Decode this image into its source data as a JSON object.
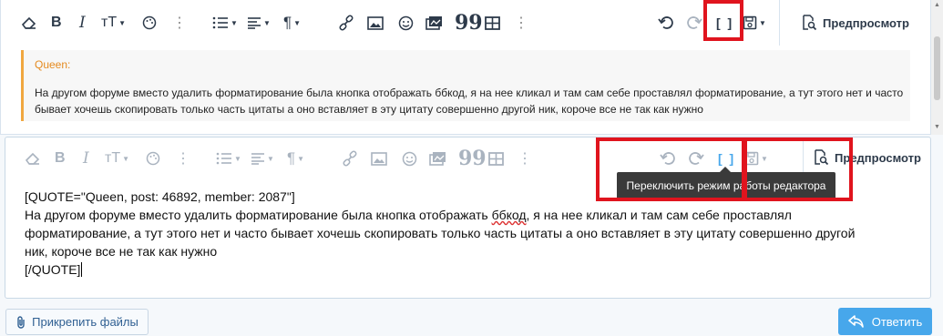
{
  "editor_top": {
    "preview_label": "Предпросмотр",
    "quote": {
      "author": "Queen:",
      "text": "На другом форуме вместо удалить форматирование была кнопка отображать ббкод, я на нее кликал и там сам себе проставлял форматирование, а тут этого нет и часто бывает хочешь скопировать только часть цитаты а оно вставляет в эту цитату совершенно другой ник, короче все не так как нужно"
    },
    "toggle_label": "[ ]"
  },
  "editor_bottom": {
    "preview_label": "Предпросмотр",
    "toggle_label": "[ ]",
    "tooltip": "Переключить режим работы редактора",
    "content": {
      "line1": "[QUOTE=\"Queen, post: 46892, member: 2087\"]",
      "line2a": "На другом форуме вместо удалить форматирование была кнопка отображать ",
      "line2_misspelled": "ббкод",
      "line2b": ", я на нее кликал и там сам себе проставлял",
      "line3": "форматирование, а тут этого нет и часто бывает хочешь скопировать только часть цитаты а оно вставляет в эту цитату совершенно другой",
      "line4": "ник, короче все не так как нужно",
      "line5": "[/QUOTE]"
    }
  },
  "footer": {
    "attach_label": "Прикрепить файлы",
    "reply_label": "Ответить"
  },
  "colors": {
    "accent": "#47a7eb",
    "quote_border": "#f0a740",
    "highlight": "#e0141e"
  }
}
